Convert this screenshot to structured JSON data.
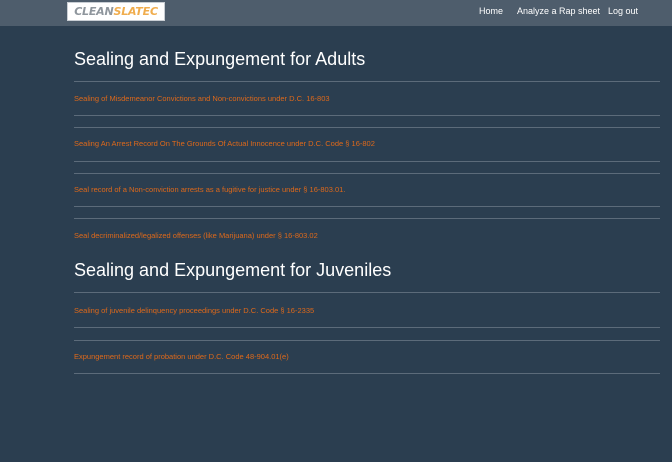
{
  "navbar": {
    "logo": {
      "clean": "CLEAN",
      "slate": "SLATE",
      "suffix": "C"
    },
    "links": [
      "Home",
      "Analyze a Rap sheet",
      "Log out"
    ]
  },
  "sections": [
    {
      "title": "Sealing and Expungement for Adults",
      "items": [
        "Sealing of Misdemeanor Convictions and Non-convictions under D.C. 16-803",
        "Sealing An Arrest Record On The Grounds Of Actual Innocence under D.C. Code § 16-802",
        "Seal record of a Non-conviction arrests as a fugitive for justice under § 16-803.01.",
        "Seal decriminalized/legalized offenses (like Marijuana) under § 16-803.02"
      ]
    },
    {
      "title": "Sealing and Expungement for Juveniles",
      "items": [
        "Sealing of juvenile delinquency proceedings under D.C. Code § 16-2335",
        "Expungement record of probation under D.C. Code 48-904.01(e)"
      ]
    }
  ],
  "colors": {
    "background": "#2b3e50",
    "navbar": "#4e5d6c",
    "link": "#df691a",
    "heading": "#ffffff",
    "rule": "#5c6b7a",
    "logo_accent": "#f0ad4e"
  }
}
